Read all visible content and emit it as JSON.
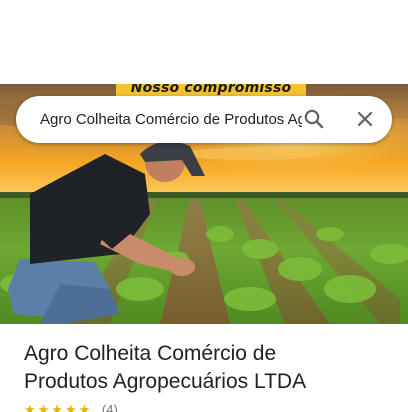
{
  "banner": {
    "text": "Nosso compromisso"
  },
  "search": {
    "value": "Agro Colheita Comércio de Produtos Agropecuários LTDA",
    "search_icon": "search-icon",
    "close_icon": "close-icon"
  },
  "place": {
    "title_line1": "Agro Colheita Comércio de",
    "title_line2": "Produtos Agropecuários LTDA",
    "stars": "★★★★★",
    "reviews": "(4)"
  },
  "colors": {
    "accent_yellow": "#f2c230",
    "star": "#e8b300",
    "title_text": "#202124",
    "icon_gray": "#5f6368"
  }
}
